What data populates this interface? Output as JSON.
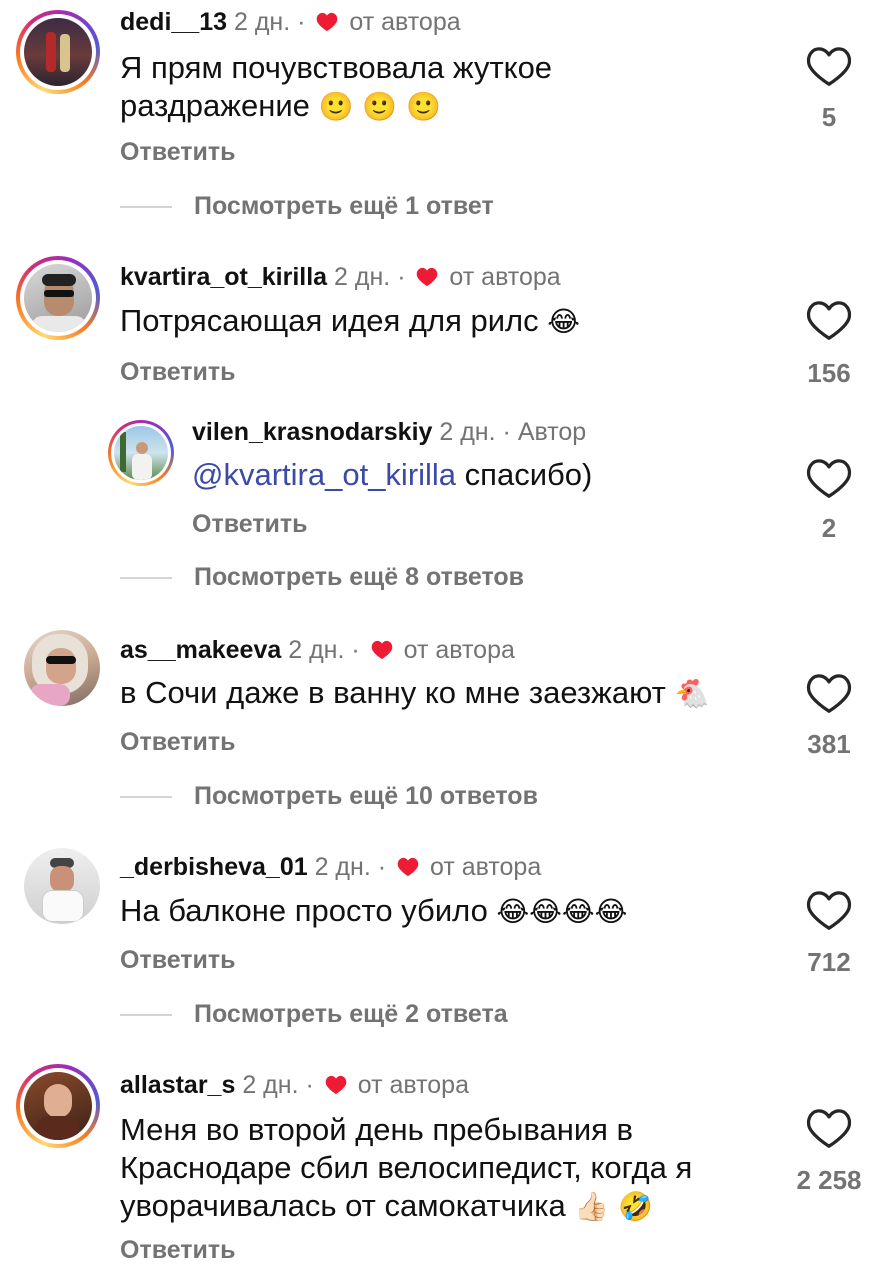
{
  "comments": [
    {
      "username": "dedi__13",
      "time": "2 дн.",
      "separator": "·",
      "liked_by_author": "от автора",
      "text": "Я прям почувствовала жуткое раздражение",
      "emojis": "🙂 🙂 🙂",
      "reply_label": "Ответить",
      "likes": "5",
      "more_replies": "Посмотреть ещё 1 ответ"
    },
    {
      "username": "kvartira_ot_kirilla",
      "time": "2 дн.",
      "separator": "·",
      "liked_by_author": "от автора",
      "text": "Потрясающая идея для рилс",
      "emojis": "😂",
      "reply_label": "Ответить",
      "likes": "156"
    },
    {
      "username": "vilen_krasnodarskiy",
      "time": "2 дн.",
      "separator": "·",
      "author_badge": "Автор",
      "mention": "@kvartira_ot_kirilla",
      "text": "спасибо)",
      "reply_label": "Ответить",
      "likes": "2",
      "more_replies": "Посмотреть ещё 8 ответов"
    },
    {
      "username": "as__makeeva",
      "time": "2 дн.",
      "separator": "·",
      "liked_by_author": "от автора",
      "text": "в Сочи даже в ванну ко мне заезжают",
      "emojis": "🐔",
      "reply_label": "Ответить",
      "likes": "381",
      "more_replies": "Посмотреть ещё 10 ответов"
    },
    {
      "username": "_derbisheva_01",
      "time": "2 дн.",
      "separator": "·",
      "liked_by_author": "от автора",
      "text": "На балконе просто убило",
      "emojis": "😂😂😂😂",
      "reply_label": "Ответить",
      "likes": "712",
      "more_replies": "Посмотреть ещё 2 ответа"
    },
    {
      "username": "allastar_s",
      "time": "2 дн.",
      "separator": "·",
      "liked_by_author": "от автора",
      "text": "Меня во второй день пребывания в Краснодаре сбил велосипедист, когда я уворачивалась от самокатчика",
      "emojis": "👍🏻 🤣",
      "reply_label": "Ответить",
      "likes": "2 258"
    }
  ],
  "icons": {
    "heart_small": "red-heart-icon",
    "like": "heart-outline-icon"
  },
  "colors": {
    "heart_red": "#ed1b33",
    "mention": "#3b4aa6",
    "secondary_text": "#737373"
  }
}
